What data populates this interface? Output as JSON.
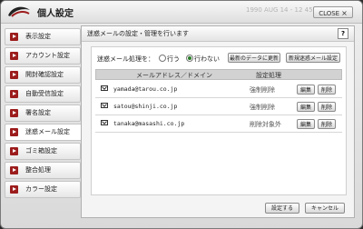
{
  "window": {
    "title": "個人設定",
    "faded_header": "1990 AUG 14 - 12 45",
    "close_label": "CLOSE",
    "close_glyph": "×"
  },
  "sidebar": {
    "items": [
      {
        "label": "表示設定"
      },
      {
        "label": "アカウント設定"
      },
      {
        "label": "開封確認設定"
      },
      {
        "label": "自動受信設定"
      },
      {
        "label": "署名設定"
      },
      {
        "label": "迷惑メール設定"
      },
      {
        "label": "ゴミ箱設定"
      },
      {
        "label": "整合処理"
      },
      {
        "label": "カラー設定"
      }
    ],
    "active_index": 5
  },
  "panel": {
    "title": "迷惑メールの設定・管理を行います",
    "help": "?",
    "mode_label": "迷惑メール処理を：",
    "radio_options": [
      {
        "label": "行う",
        "checked": false
      },
      {
        "label": "行わない",
        "checked": true
      }
    ],
    "refresh_button": "最新のデータに更新",
    "new_button": "新規迷惑メール設定",
    "table": {
      "headers": [
        "メールアドレス／ドメイン",
        "設定処理"
      ],
      "rows": [
        {
          "email": "yamada@tarou.co.jp",
          "action": "強制削除",
          "edit": "編集",
          "delete": "削除"
        },
        {
          "email": "satou@shinji.co.jp",
          "action": "強制削除",
          "edit": "編集",
          "delete": "削除"
        },
        {
          "email": "tanaka@masashi.co.jp",
          "action": "削除対象外",
          "edit": "編集",
          "delete": "削除"
        }
      ]
    },
    "save_button": "設定する",
    "cancel_button": "キャンセル"
  },
  "colors": {
    "accent": "#9c1c1c",
    "radio_on": "#2a7d2a",
    "header_bg": "#d2d2d2"
  }
}
